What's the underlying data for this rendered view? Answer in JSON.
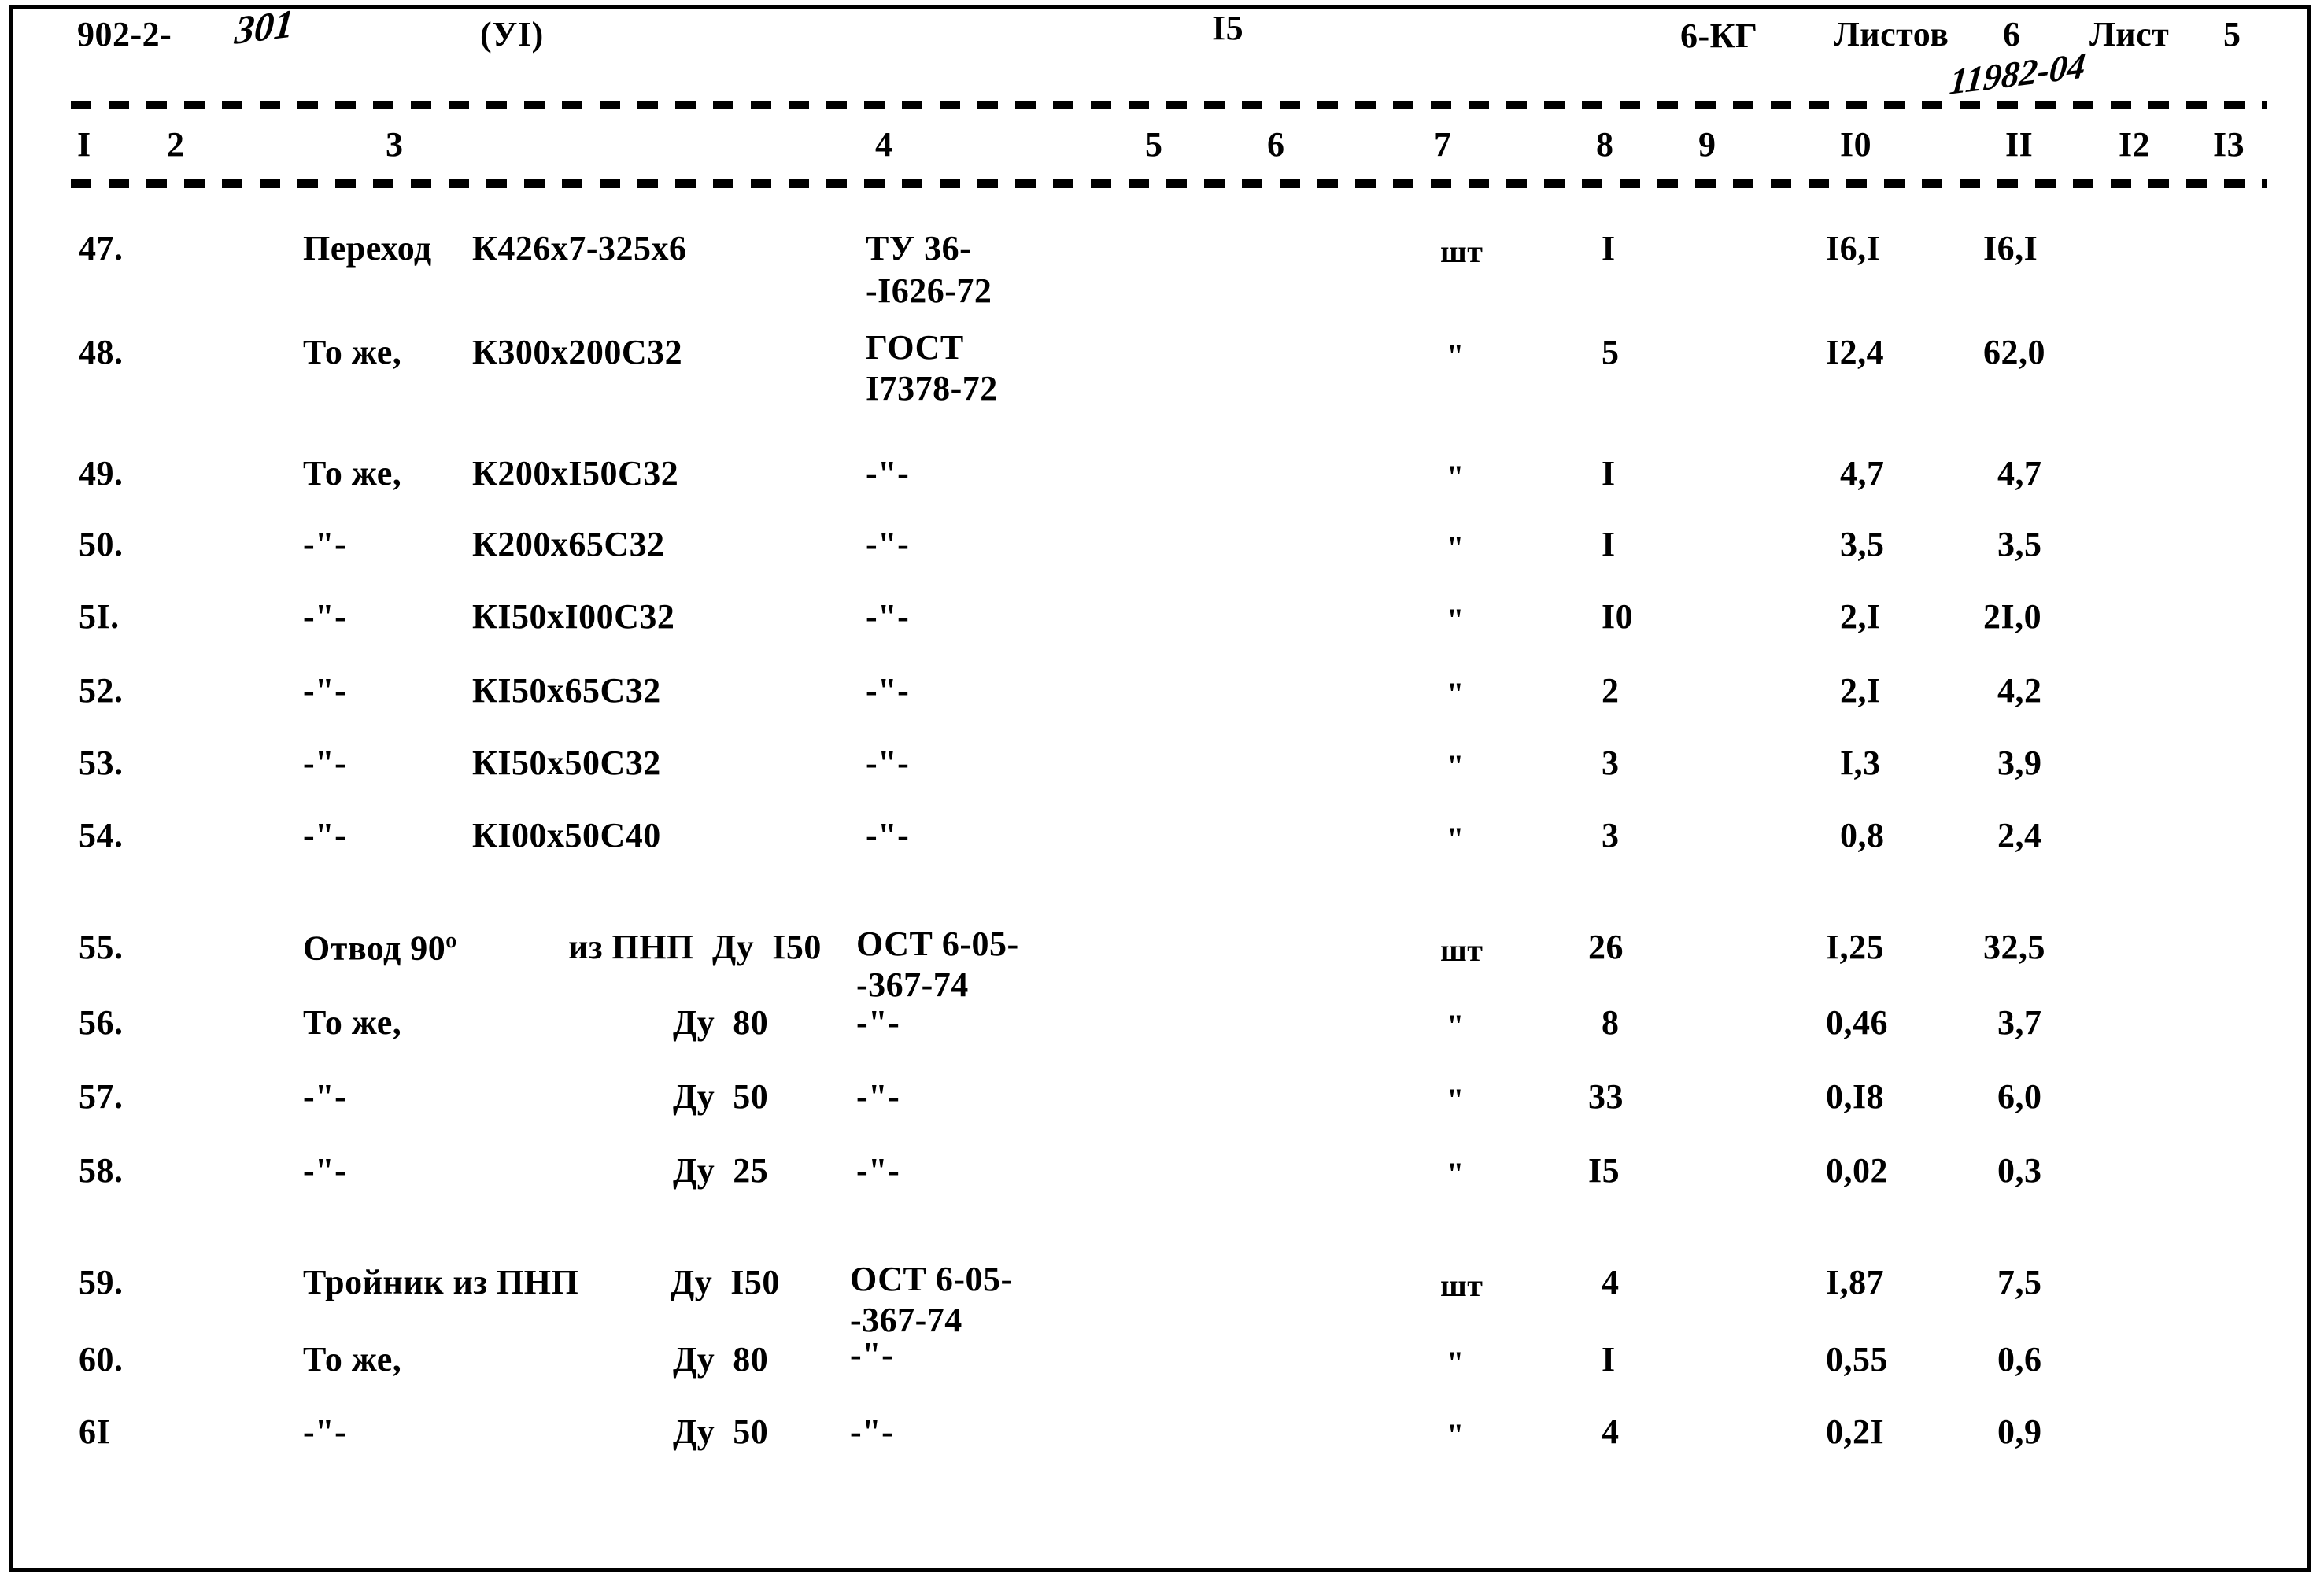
{
  "document": {
    "header": {
      "series_code": "902-2-",
      "series_handwritten": "301",
      "section": "(УI)",
      "page_center_number": "I5",
      "doc_mark": "6-КГ",
      "sheets_label": "Листов",
      "sheets_count": "6",
      "sheet_label": "Лист",
      "sheet_number": "5",
      "handwritten_note": "11982-04"
    },
    "column_numbers": [
      "I",
      "2",
      "3",
      "4",
      "5",
      "6",
      "7",
      "8",
      "9",
      "I0",
      "II",
      "I2",
      "I3"
    ],
    "rows": [
      {
        "num": "47.",
        "name_a": "Переход",
        "name_b": "К426х7-325х6",
        "name_c": "",
        "std_line1": "ТУ 36-",
        "std_line2": "-I626-72",
        "unit": "шт",
        "qty": "I",
        "unit_weight": "I6,I",
        "total_weight": "I6,I"
      },
      {
        "num": "48.",
        "name_a": "То же,",
        "name_b": "К300х200С32",
        "name_c": "",
        "std_line1": "ГОСТ",
        "std_line2": "I7378-72",
        "unit": "\"",
        "qty": "5",
        "unit_weight": "I2,4",
        "total_weight": "62,0"
      },
      {
        "num": "49.",
        "name_a": "То же,",
        "name_b": "К200хI50С32",
        "name_c": "",
        "std_line1": "-\"-",
        "std_line2": "",
        "unit": "\"",
        "qty": "I",
        "unit_weight": "4,7",
        "total_weight": "4,7"
      },
      {
        "num": "50.",
        "name_a": "-\"-",
        "name_b": "К200х65С32",
        "name_c": "",
        "std_line1": "-\"-",
        "std_line2": "",
        "unit": "\"",
        "qty": "I",
        "unit_weight": "3,5",
        "total_weight": "3,5"
      },
      {
        "num": "5I.",
        "name_a": "-\"-",
        "name_b": "КI50хI00С32",
        "name_c": "",
        "std_line1": "-\"-",
        "std_line2": "",
        "unit": "\"",
        "qty": "I0",
        "unit_weight": "2,I",
        "total_weight": "2I,0"
      },
      {
        "num": "52.",
        "name_a": "-\"-",
        "name_b": "КI50х65С32",
        "name_c": "",
        "std_line1": "-\"-",
        "std_line2": "",
        "unit": "\"",
        "qty": "2",
        "unit_weight": "2,I",
        "total_weight": "4,2"
      },
      {
        "num": "53.",
        "name_a": "-\"-",
        "name_b": "КI50х50С32",
        "name_c": "",
        "std_line1": "-\"-",
        "std_line2": "",
        "unit": "\"",
        "qty": "3",
        "unit_weight": "I,3",
        "total_weight": "3,9"
      },
      {
        "num": "54.",
        "name_a": "-\"-",
        "name_b": "КI00х50С40",
        "name_c": "",
        "std_line1": "-\"-",
        "std_line2": "",
        "unit": "\"",
        "qty": "3",
        "unit_weight": "0,8",
        "total_weight": "2,4"
      },
      {
        "num": "55.",
        "name_a": "Отвод 90",
        "name_sup": "о",
        "name_b": "из ПНП",
        "name_c": "Ду  I50",
        "std_line1": "ОСТ 6-05-",
        "std_line2": "-367-74",
        "unit": "шт",
        "qty": "26",
        "unit_weight": "I,25",
        "total_weight": "32,5"
      },
      {
        "num": "56.",
        "name_a": "То же,",
        "name_b": "",
        "name_c": "Ду  80",
        "std_line1": "-\"-",
        "std_line2": "",
        "unit": "\"",
        "qty": "8",
        "unit_weight": "0,46",
        "total_weight": "3,7"
      },
      {
        "num": "57.",
        "name_a": "-\"-",
        "name_b": "",
        "name_c": "Ду  50",
        "std_line1": "-\"-",
        "std_line2": "",
        "unit": "\"",
        "qty": "33",
        "unit_weight": "0,I8",
        "total_weight": "6,0"
      },
      {
        "num": "58.",
        "name_a": "-\"-",
        "name_b": "",
        "name_c": "Ду  25",
        "std_line1": "-\"-",
        "std_line2": "",
        "unit": "\"",
        "qty": "I5",
        "unit_weight": "0,02",
        "total_weight": "0,3"
      },
      {
        "num": "59.",
        "name_a": "Тройник из ПНП",
        "name_b": "",
        "name_c": "Ду  I50",
        "std_line1": "ОСТ 6-05-",
        "std_line2": "-367-74",
        "unit": "шт",
        "qty": "4",
        "unit_weight": "I,87",
        "total_weight": "7,5"
      },
      {
        "num": "60.",
        "name_a": "То же,",
        "name_b": "",
        "name_c": "Ду  80",
        "std_line1": "-\"-",
        "std_line2": "",
        "unit": "\"",
        "qty": "I",
        "unit_weight": "0,55",
        "total_weight": "0,6"
      },
      {
        "num": "6I",
        "name_a": "-\"-",
        "name_b": "",
        "name_c": "Ду  50",
        "std_line1": "-\"-",
        "std_line2": "",
        "unit": "\"",
        "qty": "4",
        "unit_weight": "0,2I",
        "total_weight": "0,9"
      }
    ]
  }
}
